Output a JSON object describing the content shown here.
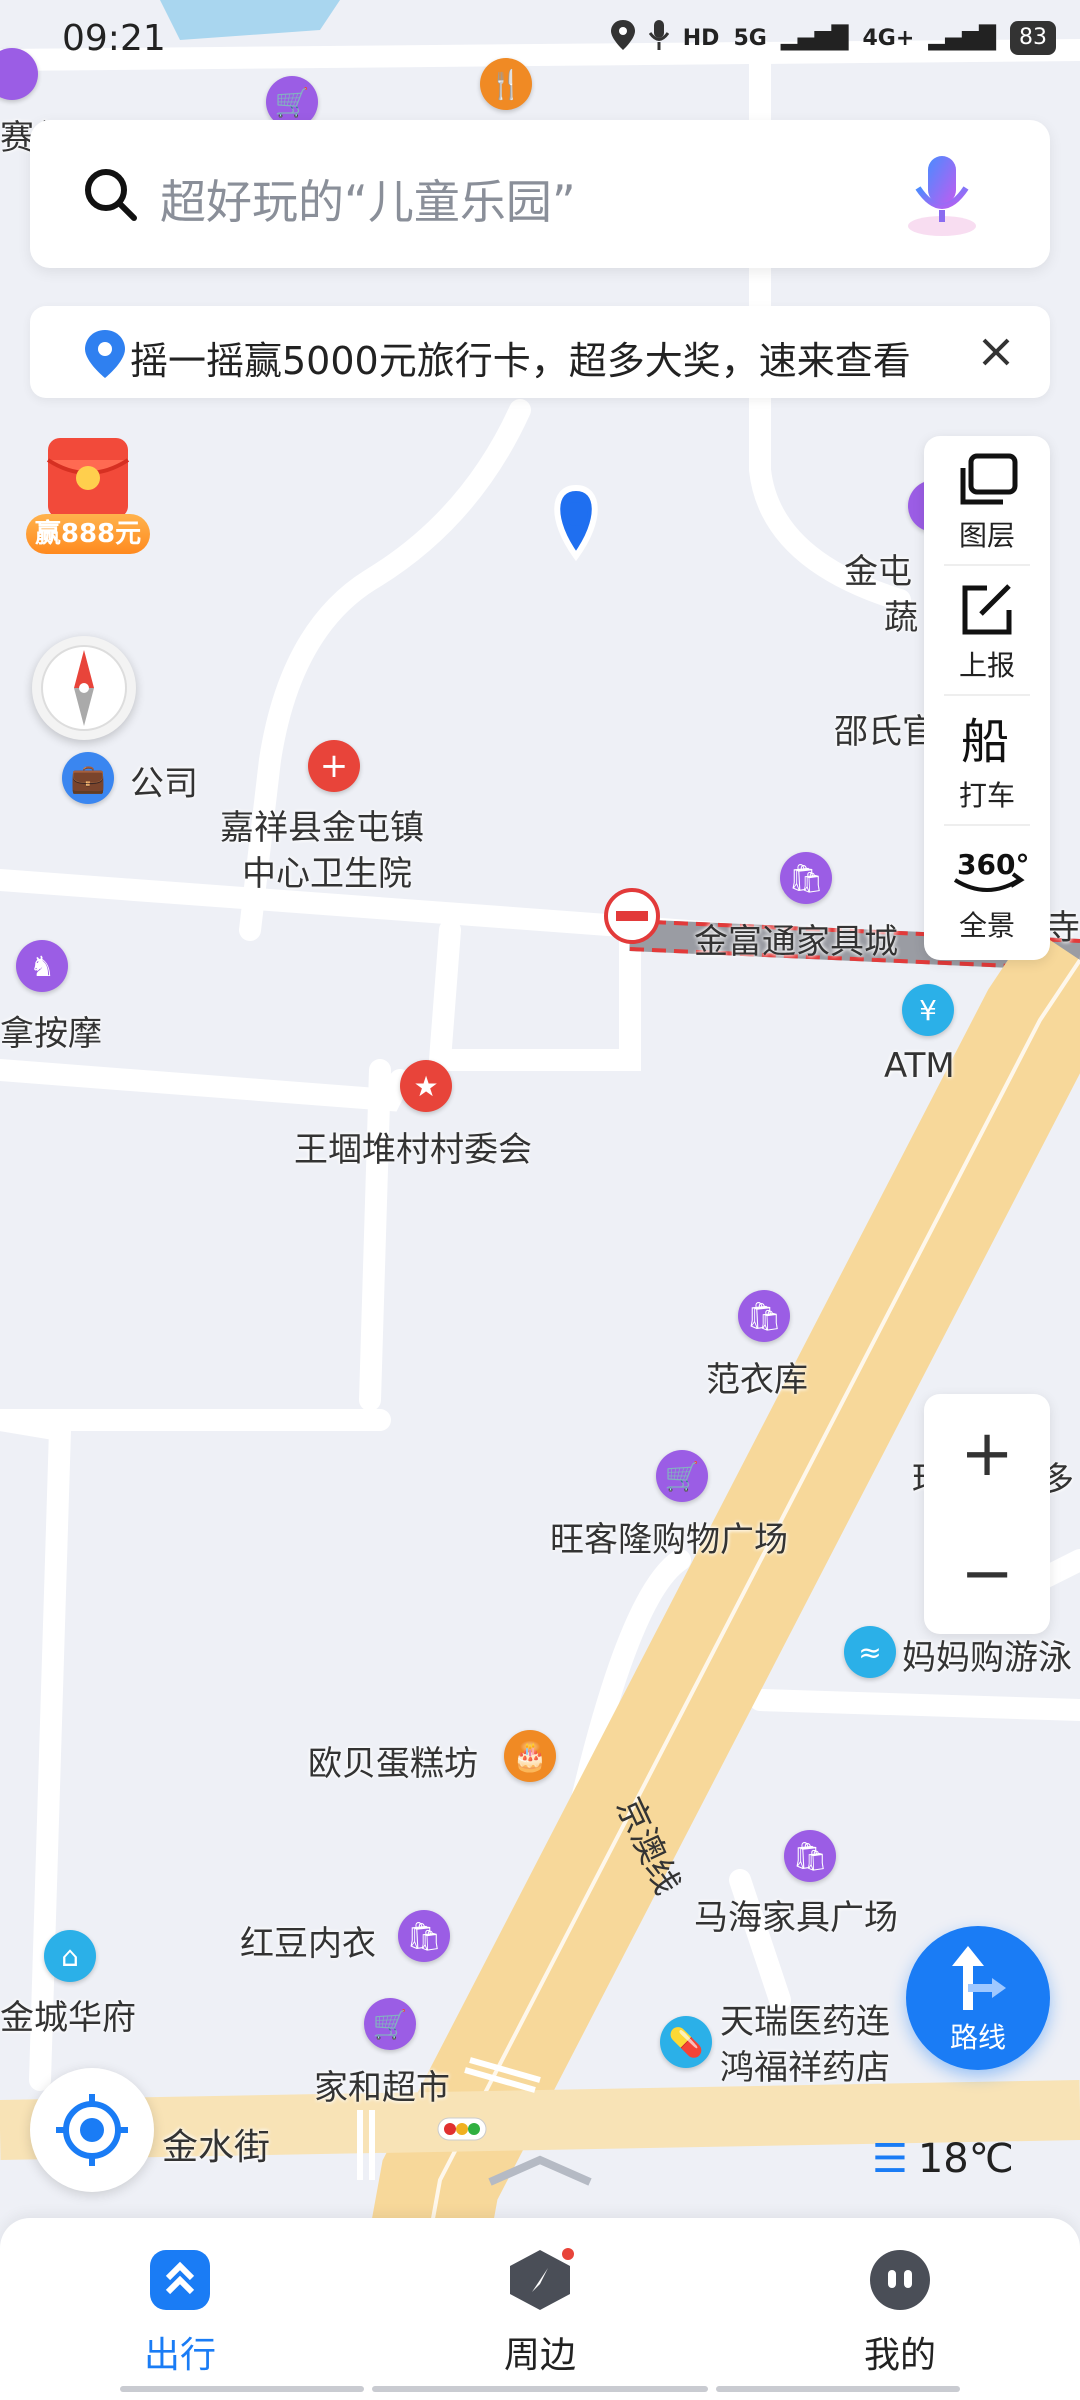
{
  "status_bar": {
    "time": "09:21",
    "hd_label": "HD",
    "network_5g": "5G",
    "network_4g": "4G+",
    "battery": "83"
  },
  "search": {
    "placeholder": "超好玩的“儿童乐园”"
  },
  "banner": {
    "text": "摇一摇赢5000元旅行卡，超多大奖，速来查看"
  },
  "red_envelope": {
    "label": "赢888元"
  },
  "toolbar": {
    "layers": "图层",
    "report": "上报",
    "taxi": "打车",
    "panorama": "全景",
    "panorama_badge": "360°"
  },
  "zoom": {
    "plus": "+",
    "minus": "−"
  },
  "route": {
    "label": "路线"
  },
  "weather": {
    "temperature": "18℃"
  },
  "map": {
    "road_label": "京澳线",
    "street_label": "金水街",
    "pois": {
      "sai_er": "赛尔",
      "company": "公司",
      "hospital_1": "嘉祥县金屯镇",
      "hospital_2": "中心卫生院",
      "jintun_1": "金屯",
      "jintun_2": "蔬",
      "shao": "邵氏官",
      "furniture_city": "金富通家具城",
      "si": "寺",
      "atm": "ATM",
      "massage": "拿按摩",
      "village": "王堌堆村村委会",
      "fan_yi_ku": "范衣库",
      "wangkelong": "旺客隆购物广场",
      "swim": "妈妈购游泳",
      "cake": "欧贝蛋糕坊",
      "mahai": "马海家具广场",
      "hongdou": "红豆内衣",
      "jincheng": "金城华府",
      "jiahe": "家和超市",
      "tianrui_1": "天瑞医药连",
      "tianrui_2": "鸿福祥药店",
      "partial_right": "珥",
      "partial_right2": "多"
    }
  },
  "nav": {
    "travel": "出行",
    "nearby": "周边",
    "mine": "我的"
  }
}
